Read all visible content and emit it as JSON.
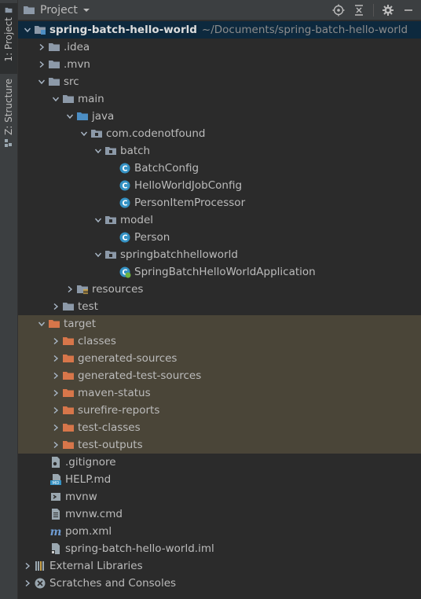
{
  "stripe": {
    "project_label": "1: Project",
    "structure_label": "Z: Structure"
  },
  "header": {
    "title": "Project"
  },
  "tree": {
    "root": {
      "label": "spring-batch-hello-world",
      "path": "~/Documents/spring-batch-hello-world"
    },
    "idea": ".idea",
    "mvn": ".mvn",
    "src": "src",
    "main": "main",
    "java": "java",
    "pkg": "com.codenotfound",
    "batch": "batch",
    "batch_config": "BatchConfig",
    "hello_job_config": "HelloWorldJobConfig",
    "person_item_processor": "PersonItemProcessor",
    "model": "model",
    "person": "Person",
    "springbatchhelloworld": "springbatchhelloworld",
    "app": "SpringBatchHelloWorldApplication",
    "resources": "resources",
    "test": "test",
    "target": "target",
    "classes": "classes",
    "generated_sources": "generated-sources",
    "generated_test_sources": "generated-test-sources",
    "maven_status": "maven-status",
    "surefire_reports": "surefire-reports",
    "test_classes": "test-classes",
    "test_outputs": "test-outputs",
    "gitignore": ".gitignore",
    "help_md": "HELP.md",
    "mvnw": "mvnw",
    "mvnw_cmd": "mvnw.cmd",
    "pom": "pom.xml",
    "iml": "spring-batch-hello-world.iml",
    "external_libraries": "External Libraries",
    "scratches": "Scratches and Consoles"
  },
  "colors": {
    "folder_blue": "#8aa4c0",
    "folder_orange": "#d7764a",
    "class_cyan": "#3592c4"
  }
}
